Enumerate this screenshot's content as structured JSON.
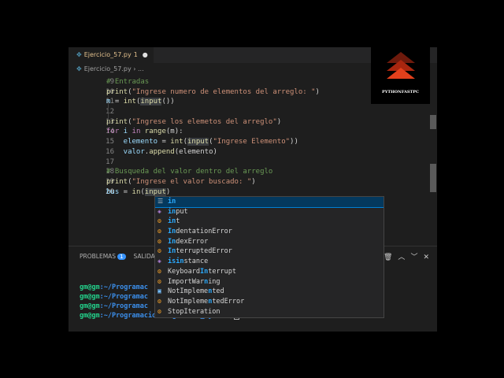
{
  "tab": {
    "filename": "Ejercicio_57.py",
    "problems": "1",
    "modified": "●",
    "icon": "python-file-icon"
  },
  "breadcrumb": {
    "file": "Ejercicio_57.py",
    "sep": " › ",
    "more": "..."
  },
  "code_lines": [
    {
      "num": "9"
    },
    {
      "num": "10"
    },
    {
      "num": "11"
    },
    {
      "num": "12"
    },
    {
      "num": "13"
    },
    {
      "num": "14"
    },
    {
      "num": "15"
    },
    {
      "num": "16"
    },
    {
      "num": "17"
    },
    {
      "num": "18"
    },
    {
      "num": "19"
    },
    {
      "num": "20"
    }
  ],
  "code_text": {
    "l9": "# Entradas",
    "l10a": "print",
    "l10b": "(",
    "l10c": "\"Ingrese numero de elementos del arreglo: \"",
    "l10d": ")",
    "l11a": "m",
    "l11b": " = ",
    "l11c": "int",
    "l11d": "(",
    "l11e": "input",
    "l11f": "())",
    "l13a": "print",
    "l13b": "(",
    "l13c": "\"Ingrese los elemetos del arreglo\"",
    "l13d": ")",
    "l14a": "for",
    "l14b": " i ",
    "l14c": "in",
    "l14d": " ",
    "l14e": "range",
    "l14f": "(m):",
    "l15a": "    elemento",
    "l15b": " = ",
    "l15c": "int",
    "l15d": "(",
    "l15e": "input",
    "l15f": "(",
    "l15g": "\"Ingrese Elemento\"",
    "l15h": "))",
    "l16a": "    valor",
    "l16b": ".",
    "l16c": "append",
    "l16d": "(elemento)",
    "l18": "# Busqueda del valor dentro del arreglo",
    "l19a": "print",
    "l19b": "(",
    "l19c": "\"Ingrese el valor buscado: \"",
    "l19d": ")",
    "l20a": "bus",
    "l20b": " = ",
    "l20c": "in",
    "l20d": "(",
    "l20e": "input",
    "l20f": ")"
  },
  "logo": {
    "label": "PYTHONFASTPC"
  },
  "panel": {
    "problems_label": "PROBLEMAS",
    "problems_count": "1",
    "output_label": "SALIDA",
    "icons": [
      "trash-icon",
      "chevron-up-icon",
      "chevron-down-icon",
      "close-icon"
    ]
  },
  "terminal": {
    "user": "gm@gm",
    "rows": [
      {
        "path": ":~/Programac"
      },
      {
        "path": ":~/Programac"
      },
      {
        "path": ":~/Programac"
      },
      {
        "path": ":~/Programacion/Algoritmo_Python",
        "suffix": "$"
      }
    ]
  },
  "suggestions": [
    {
      "pre": "",
      "m": "in",
      "post": "",
      "kind": "keyword"
    },
    {
      "pre": "",
      "m": "in",
      "post": "put",
      "kind": "function"
    },
    {
      "pre": "",
      "m": "in",
      "post": "t",
      "kind": "class"
    },
    {
      "pre": "",
      "m": "In",
      "post": "dentationError",
      "kind": "class"
    },
    {
      "pre": "",
      "m": "In",
      "post": "dexError",
      "kind": "class"
    },
    {
      "pre": "",
      "m": "In",
      "post": "terruptedError",
      "kind": "class"
    },
    {
      "pre": "",
      "m": "isin",
      "post": "stance",
      "kind": "function"
    },
    {
      "pre": "Keyboard",
      "m": "In",
      "post": "terrupt",
      "kind": "class"
    },
    {
      "pre": "ImportWar",
      "m": "n",
      "post": "ing",
      "kind": "class"
    },
    {
      "pre": "NotImpleme",
      "m": "n",
      "post": "ted",
      "kind": "variable"
    },
    {
      "pre": "NotImpleme",
      "m": "n",
      "post": "tedError",
      "kind": "class"
    },
    {
      "pre": "StopIteration",
      "m": "",
      "post": "",
      "kind": "class"
    }
  ]
}
